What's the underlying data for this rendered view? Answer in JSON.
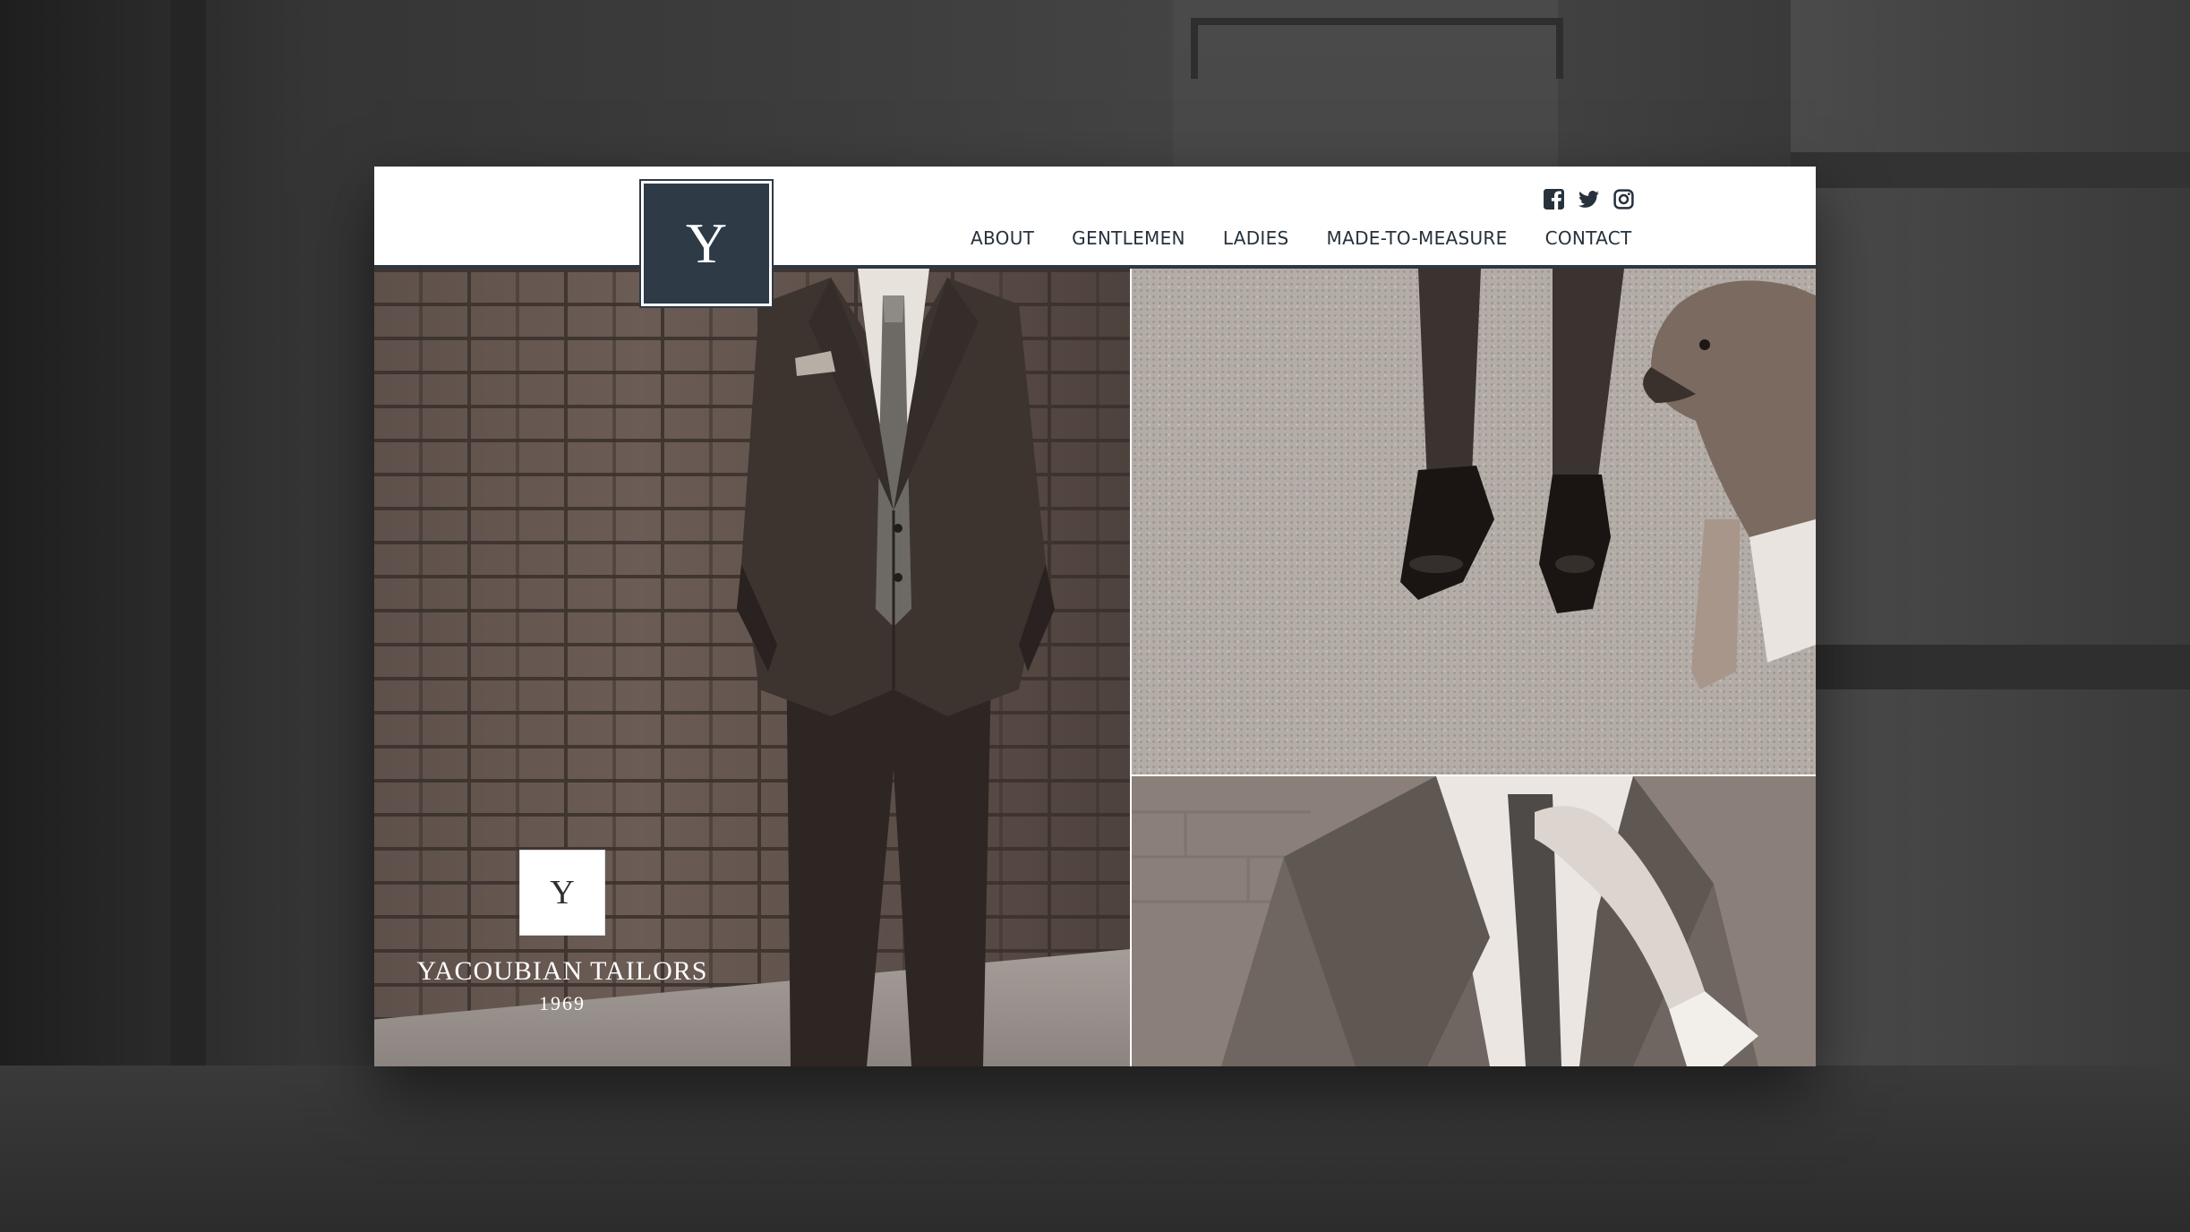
{
  "header": {
    "logo_letter": "Y",
    "nav": [
      "ABOUT",
      "GENTLEMEN",
      "LADIES",
      "MADE-TO-MEASURE",
      "CONTACT"
    ],
    "social": [
      "facebook-icon",
      "twitter-icon",
      "instagram-icon"
    ]
  },
  "hero": {
    "brand_logo_letter": "Y",
    "brand_name": "YACOUBIAN TAILORS",
    "brand_year": "1969"
  },
  "colors": {
    "header_accent": "#2e3a46",
    "nav_text": "#26313c",
    "backdrop": "#2c2c2c"
  }
}
